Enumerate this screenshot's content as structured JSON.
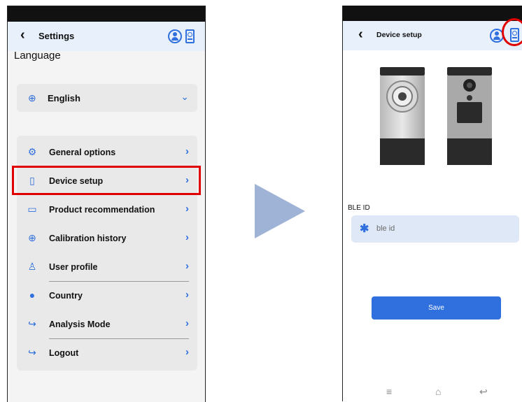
{
  "settings_screen": {
    "header": {
      "title": "Settings",
      "back_glyph": "‹"
    },
    "language": {
      "heading": "Language",
      "value": "English"
    },
    "menu": [
      {
        "label": "General options",
        "icon": "settings-icon"
      },
      {
        "label": "Device setup",
        "icon": "device-icon",
        "highlighted": true
      },
      {
        "label": "Product recommendation",
        "icon": "product-icon"
      },
      {
        "label": "Calibration history",
        "icon": "calibration-icon"
      },
      {
        "label": "User profile",
        "icon": "user-icon"
      },
      {
        "label": "Country",
        "icon": "globe-icon"
      },
      {
        "label": "Analysis Mode",
        "icon": "mode-icon"
      },
      {
        "label": "Logout",
        "icon": "logout-icon"
      }
    ]
  },
  "device_setup_screen": {
    "header": {
      "title": "Device setup",
      "back_glyph": "‹"
    },
    "ble": {
      "label": "BLE ID",
      "placeholder": "ble id"
    },
    "save_label": "Save"
  },
  "colors": {
    "accent": "#2f6fde",
    "highlight": "#e00000",
    "header_bg": "#e8f0fb",
    "card_bg": "#e9e9e9"
  }
}
